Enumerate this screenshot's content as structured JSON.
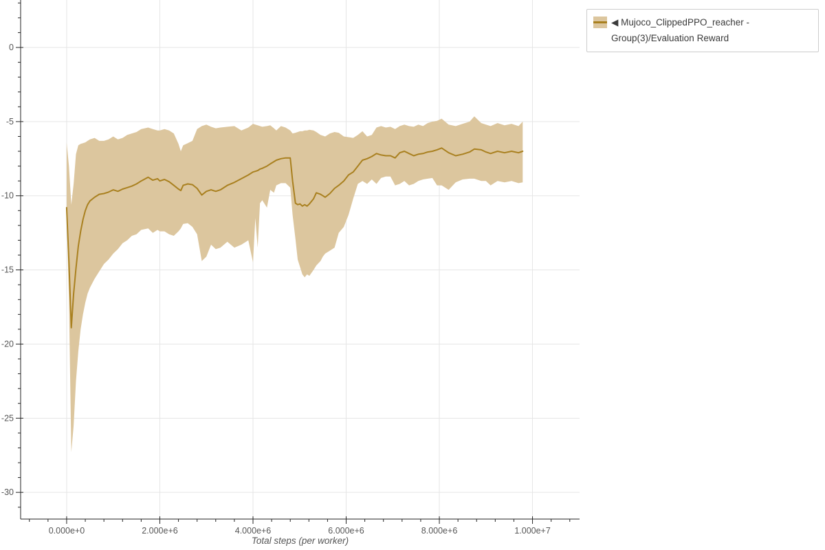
{
  "chart_data": {
    "type": "line",
    "title": "",
    "xlabel": "Total steps (per worker)",
    "ylabel": "",
    "grid": true,
    "x_axis": {
      "lim": [
        -988000,
        11010000
      ],
      "major_ticks": [
        0,
        2000000,
        4000000,
        6000000,
        8000000,
        10000000
      ],
      "tick_labels": [
        "0.000e+0",
        "2.000e+6",
        "4.000e+6",
        "6.000e+6",
        "8.000e+6",
        "1.000e+7"
      ],
      "minor_step": 400000
    },
    "y_axis": {
      "lim": [
        -31.8,
        3.2
      ],
      "major_ticks": [
        0,
        -5,
        -10,
        -15,
        -20,
        -25,
        -30
      ],
      "tick_labels": [
        "0",
        "-5",
        "-10",
        "-15",
        "-20",
        "-25",
        "-30"
      ],
      "minor_step": 1
    },
    "colors": {
      "band": "#dcc69e",
      "line": "#a9801f",
      "grid": "#e5e5e5",
      "axis": "#222222",
      "tick_label": "#555555",
      "axis_title": "#555555",
      "legend_border": "#cccccc",
      "legend_text": "#3a3a3a"
    },
    "legend": {
      "position": "top-right",
      "label": "◀ Mujoco_ClippedPPO_reacher - Group(3)/Evaluation Reward"
    },
    "series": [
      {
        "name": "Mujoco_ClippedPPO_reacher - Group(3)/Evaluation Reward",
        "x": [
          0,
          50000,
          100000,
          150000,
          200000,
          250000,
          300000,
          350000,
          400000,
          450000,
          500000,
          600000,
          700000,
          800000,
          900000,
          1000000,
          1100000,
          1200000,
          1300000,
          1400000,
          1500000,
          1600000,
          1750000,
          1850000,
          1950000,
          2000000,
          2100000,
          2200000,
          2300000,
          2400000,
          2450000,
          2500000,
          2600000,
          2700000,
          2800000,
          2900000,
          3000000,
          3100000,
          3200000,
          3300000,
          3450000,
          3600000,
          3750000,
          3900000,
          4000000,
          4050000,
          4100000,
          4150000,
          4200000,
          4300000,
          4370000,
          4450000,
          4500000,
          4600000,
          4700000,
          4800000,
          4850000,
          4910000,
          4960000,
          5010000,
          5060000,
          5110000,
          5160000,
          5210000,
          5300000,
          5360000,
          5450000,
          5500000,
          5550000,
          5650000,
          5750000,
          5840000,
          5950000,
          6050000,
          6150000,
          6250000,
          6350000,
          6450000,
          6550000,
          6650000,
          6750000,
          6850000,
          6950000,
          7050000,
          7150000,
          7250000,
          7350000,
          7450000,
          7550000,
          7650000,
          7750000,
          7850000,
          7950000,
          8050000,
          8200000,
          8350000,
          8500000,
          8650000,
          8750000,
          8900000,
          9000000,
          9100000,
          9250000,
          9400000,
          9550000,
          9700000,
          9790000
        ],
        "y_mean": [
          -10.8,
          -14.5,
          -18.9,
          -16.6,
          -14.9,
          -13.4,
          -12.4,
          -11.6,
          -11.0,
          -10.6,
          -10.35,
          -10.1,
          -9.9,
          -9.85,
          -9.75,
          -9.6,
          -9.7,
          -9.55,
          -9.45,
          -9.35,
          -9.2,
          -9.0,
          -8.75,
          -8.95,
          -8.85,
          -9.0,
          -8.9,
          -9.05,
          -9.3,
          -9.55,
          -9.65,
          -9.3,
          -9.2,
          -9.25,
          -9.5,
          -9.95,
          -9.7,
          -9.6,
          -9.7,
          -9.6,
          -9.3,
          -9.1,
          -8.85,
          -8.6,
          -8.4,
          -8.35,
          -8.3,
          -8.2,
          -8.15,
          -8.0,
          -7.85,
          -7.7,
          -7.6,
          -7.5,
          -7.45,
          -7.45,
          -9.0,
          -10.5,
          -10.6,
          -10.55,
          -10.7,
          -10.6,
          -10.7,
          -10.55,
          -10.2,
          -9.8,
          -9.9,
          -10.0,
          -10.1,
          -9.85,
          -9.5,
          -9.3,
          -9.0,
          -8.6,
          -8.4,
          -8.0,
          -7.6,
          -7.5,
          -7.35,
          -7.15,
          -7.25,
          -7.3,
          -7.3,
          -7.45,
          -7.1,
          -7.0,
          -7.15,
          -7.3,
          -7.2,
          -7.15,
          -7.05,
          -7.0,
          -6.9,
          -6.78,
          -7.1,
          -7.3,
          -7.2,
          -7.05,
          -6.85,
          -6.9,
          -7.05,
          -7.15,
          -7.0,
          -7.1,
          -7.0,
          -7.1,
          -7.0
        ],
        "y_upper": [
          -6.4,
          -8.0,
          -10.6,
          -9.2,
          -7.2,
          -6.6,
          -6.5,
          -6.45,
          -6.4,
          -6.3,
          -6.2,
          -6.1,
          -6.3,
          -6.3,
          -6.2,
          -6.0,
          -6.2,
          -6.1,
          -5.9,
          -5.8,
          -5.7,
          -5.5,
          -5.4,
          -5.5,
          -5.6,
          -5.6,
          -5.5,
          -5.6,
          -5.8,
          -6.5,
          -7.0,
          -6.6,
          -6.45,
          -6.3,
          -5.5,
          -5.3,
          -5.2,
          -5.35,
          -5.45,
          -5.4,
          -5.35,
          -5.3,
          -5.6,
          -5.4,
          -5.15,
          -5.2,
          -5.25,
          -5.3,
          -5.35,
          -5.3,
          -5.25,
          -5.45,
          -5.6,
          -5.3,
          -5.4,
          -5.6,
          -5.8,
          -5.75,
          -5.7,
          -5.65,
          -5.65,
          -5.6,
          -5.6,
          -5.55,
          -5.6,
          -5.7,
          -5.9,
          -5.95,
          -6.0,
          -5.8,
          -5.7,
          -5.75,
          -6.0,
          -6.05,
          -6.1,
          -5.9,
          -5.65,
          -6.0,
          -5.9,
          -5.4,
          -5.3,
          -5.4,
          -5.35,
          -5.5,
          -5.3,
          -5.2,
          -5.3,
          -5.35,
          -5.2,
          -5.3,
          -5.1,
          -5.0,
          -4.95,
          -4.8,
          -5.2,
          -5.3,
          -5.15,
          -5.0,
          -4.65,
          -5.1,
          -5.2,
          -5.3,
          -5.1,
          -5.25,
          -5.15,
          -5.3,
          -5.0
        ],
        "y_lower": [
          -11.3,
          -17.0,
          -27.3,
          -25.5,
          -22.5,
          -20.5,
          -19.0,
          -18.0,
          -17.2,
          -16.6,
          -16.2,
          -15.6,
          -15.1,
          -14.6,
          -14.3,
          -13.9,
          -13.6,
          -13.2,
          -13.0,
          -12.7,
          -12.6,
          -12.3,
          -12.2,
          -12.5,
          -12.3,
          -12.4,
          -12.4,
          -12.6,
          -12.7,
          -12.4,
          -12.2,
          -11.9,
          -11.85,
          -12.1,
          -12.6,
          -14.4,
          -14.1,
          -13.3,
          -13.6,
          -13.5,
          -13.1,
          -13.5,
          -13.3,
          -13.0,
          -14.5,
          -11.5,
          -13.5,
          -10.5,
          -10.3,
          -10.8,
          -9.6,
          -9.8,
          -9.3,
          -9.15,
          -9.15,
          -9.45,
          -11.3,
          -12.9,
          -14.3,
          -14.8,
          -15.3,
          -15.5,
          -15.3,
          -15.4,
          -15.0,
          -14.7,
          -14.4,
          -14.1,
          -13.9,
          -13.7,
          -13.5,
          -12.5,
          -12.1,
          -11.3,
          -10.2,
          -9.2,
          -9.0,
          -9.2,
          -8.9,
          -9.2,
          -8.8,
          -8.7,
          -8.7,
          -9.3,
          -9.2,
          -9.0,
          -9.3,
          -9.2,
          -9.0,
          -8.9,
          -8.85,
          -8.8,
          -9.3,
          -9.3,
          -9.6,
          -9.1,
          -8.9,
          -8.85,
          -8.85,
          -9.0,
          -9.0,
          -9.3,
          -9.0,
          -9.1,
          -9.0,
          -9.15,
          -9.1
        ]
      }
    ]
  }
}
